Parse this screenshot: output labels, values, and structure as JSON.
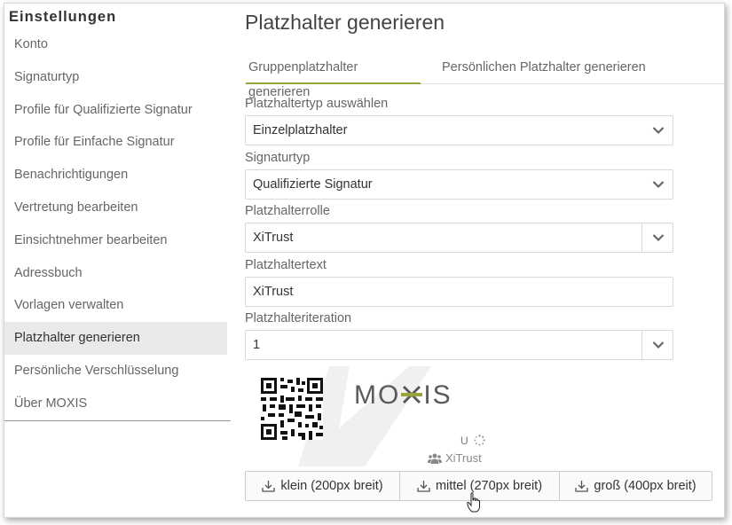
{
  "sidebar": {
    "title": "Einstellungen",
    "items": [
      {
        "label": "Konto"
      },
      {
        "label": "Signaturtyp"
      },
      {
        "label": "Profile für Qualifizierte Signatur"
      },
      {
        "label": "Profile für Einfache Signatur"
      },
      {
        "label": "Benachrichtigungen"
      },
      {
        "label": "Vertretung bearbeiten"
      },
      {
        "label": "Einsichtnehmer bearbeiten"
      },
      {
        "label": "Adressbuch"
      },
      {
        "label": "Vorlagen verwalten"
      },
      {
        "label": "Platzhalter generieren",
        "active": true
      },
      {
        "label": "Persönliche Verschlüsselung"
      },
      {
        "label": "Über MOXIS"
      }
    ]
  },
  "main": {
    "title": "Platzhalter generieren",
    "tabs": [
      {
        "label": "Gruppenplatzhalter generieren",
        "active": true
      },
      {
        "label": "Persönlichen Platzhalter generieren"
      }
    ],
    "form": {
      "type_label": "Platzhaltertyp auswählen",
      "type_value": "Einzelplatzhalter",
      "signature_label": "Signaturtyp",
      "signature_value": "Qualifizierte Signatur",
      "role_label": "Platzhalterrolle",
      "role_value": "XiTrust",
      "text_label": "Platzhaltertext",
      "text_value": "XiTrust",
      "iteration_label": "Platzhalteriteration",
      "iteration_value": "1"
    },
    "preview": {
      "logo_left": "MO",
      "logo_right": "IS",
      "user_initial": "U",
      "group_name": "XiTrust"
    },
    "buttons": {
      "small": "klein (200px breit)",
      "medium": "mittel (270px breit)",
      "large": "groß (400px breit)"
    }
  },
  "colors": {
    "accent": "#9aa33a",
    "active_item_bg": "#e9e9e9"
  },
  "icons": [
    "chevron-down-icon",
    "download-icon",
    "users-icon",
    "spinner-icon",
    "qr-code-icon",
    "hand-pointer-cursor"
  ]
}
